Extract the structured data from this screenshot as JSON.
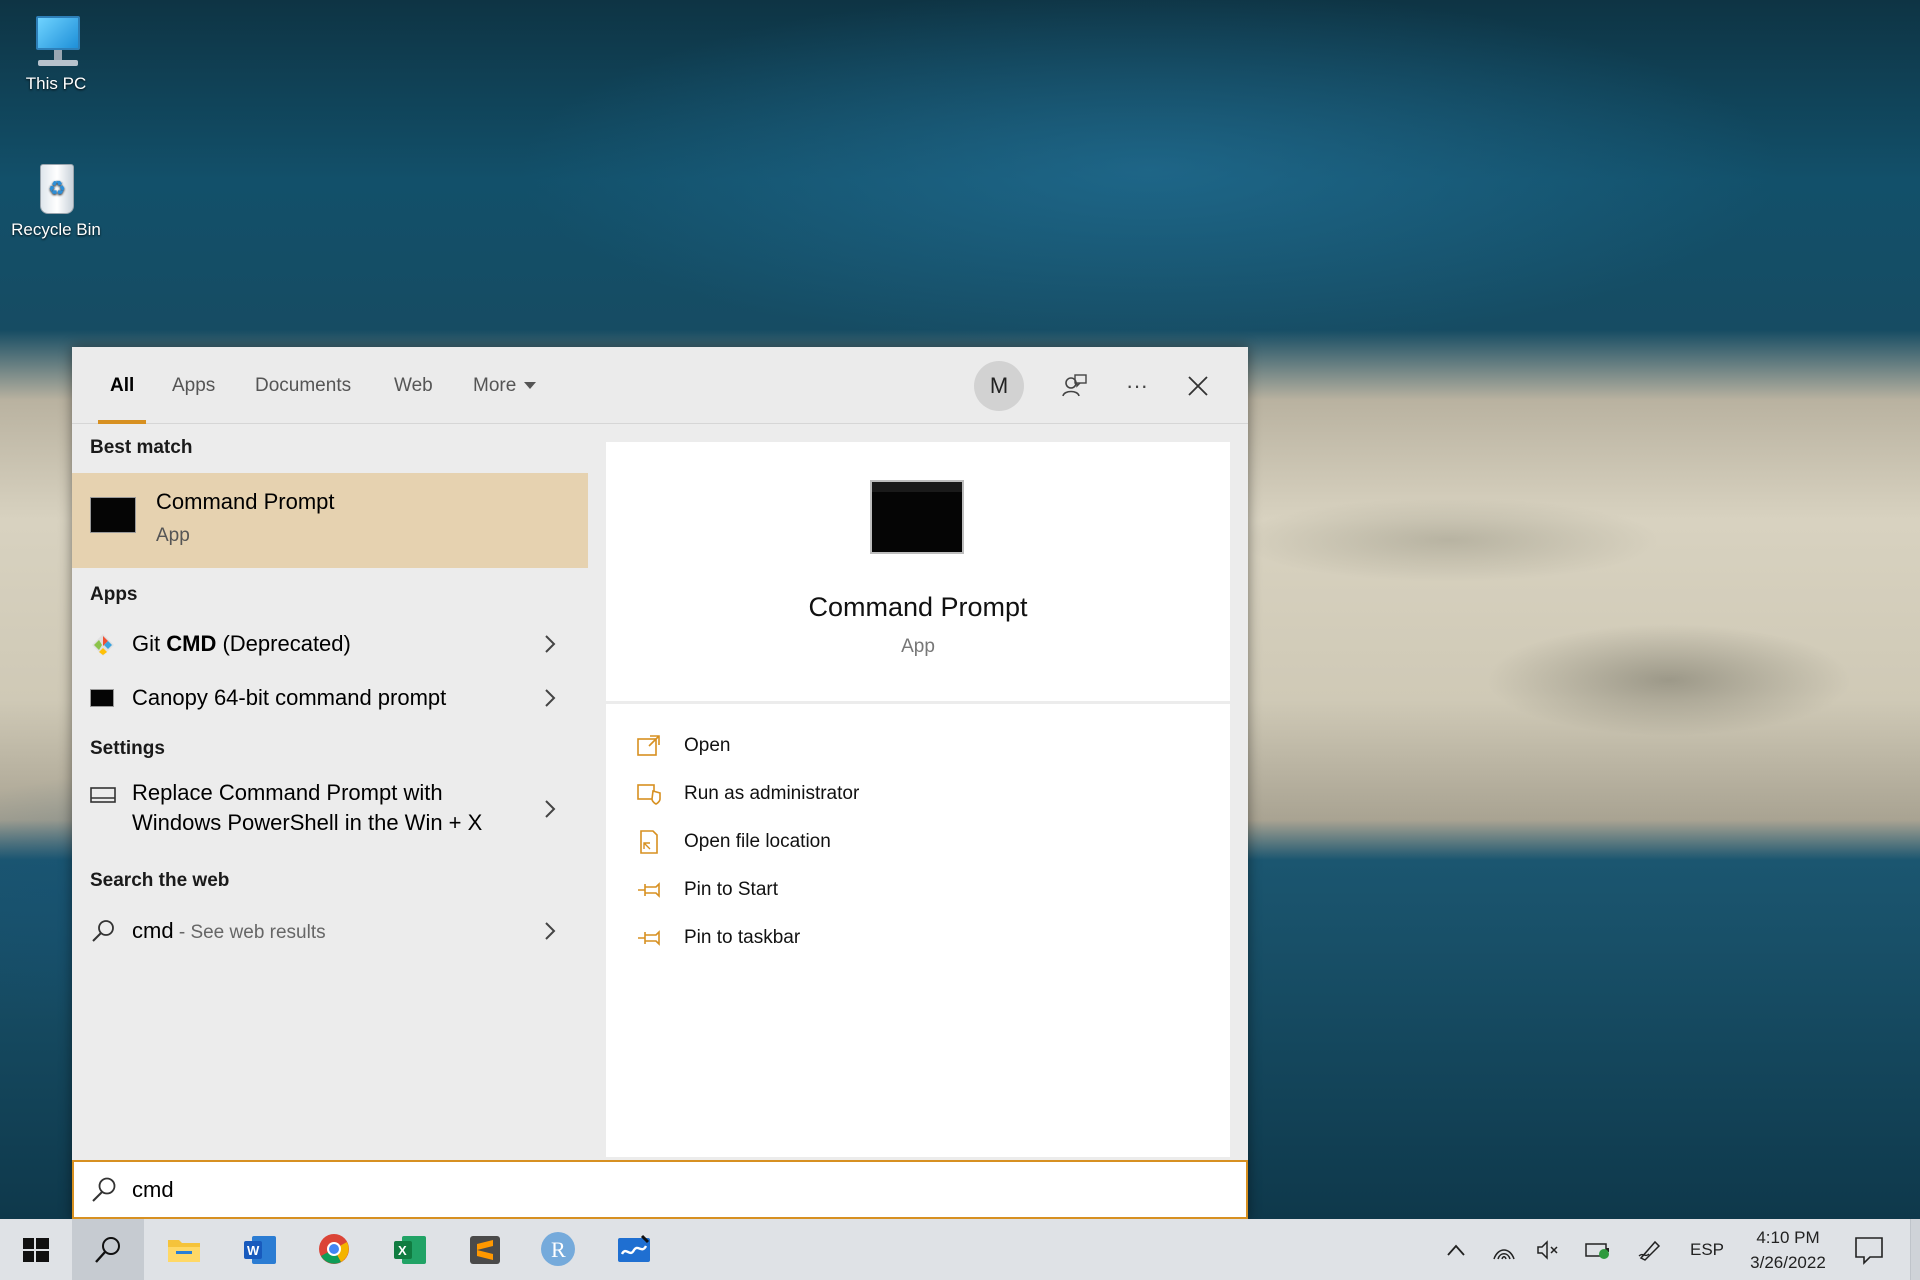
{
  "desktop": {
    "icons": [
      {
        "label": "This PC"
      },
      {
        "label": "Recycle Bin"
      }
    ]
  },
  "search": {
    "tabs": [
      {
        "label": "All"
      },
      {
        "label": "Apps"
      },
      {
        "label": "Documents"
      },
      {
        "label": "Web"
      },
      {
        "label": "More"
      }
    ],
    "avatar_initial": "M",
    "query": "cmd",
    "sections": {
      "best_match": "Best match",
      "apps": "Apps",
      "settings": "Settings",
      "web": "Search the web"
    },
    "best_match": {
      "title": "Command Prompt",
      "subtitle": "App"
    },
    "apps": [
      {
        "prefix": "Git ",
        "bold": "CMD",
        "suffix": " (Deprecated)"
      },
      {
        "label": "Canopy 64-bit command prompt"
      }
    ],
    "settings": [
      {
        "line1": "Replace Command Prompt with",
        "line2": "Windows PowerShell in the Win + X"
      }
    ],
    "web": {
      "term": "cmd",
      "sub": " - See web results"
    },
    "preview": {
      "title": "Command Prompt",
      "subtitle": "App",
      "actions": [
        {
          "label": "Open",
          "icon": "open-icon"
        },
        {
          "label": "Run as administrator",
          "icon": "shield-icon"
        },
        {
          "label": "Open file location",
          "icon": "file-location-icon"
        },
        {
          "label": "Pin to Start",
          "icon": "pin-icon"
        },
        {
          "label": "Pin to taskbar",
          "icon": "pin-icon"
        }
      ]
    },
    "accent_color": "#d79021"
  },
  "taskbar": {
    "apps": [
      "start-icon",
      "search-icon",
      "file-explorer-icon",
      "word-icon",
      "chrome-icon",
      "excel-icon",
      "sublime-icon",
      "r-icon",
      "whiteboard-icon"
    ],
    "tray": {
      "language": "ESP",
      "time": "4:10 PM",
      "date": "3/26/2022"
    }
  }
}
